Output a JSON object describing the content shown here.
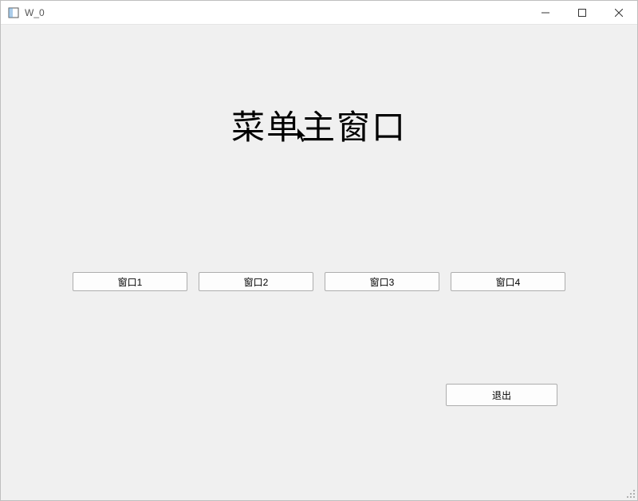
{
  "window": {
    "title": "W_0"
  },
  "heading": "菜单主窗口",
  "buttons": {
    "b1": "窗口1",
    "b2": "窗口2",
    "b3": "窗口3",
    "b4": "窗口4"
  },
  "exit_label": "退出"
}
